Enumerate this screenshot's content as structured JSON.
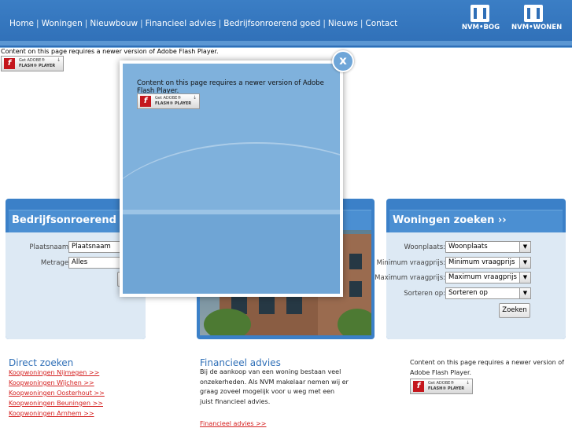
{
  "nav": {
    "items": [
      "Home",
      "Woningen",
      "Nieuwbouw",
      "Financieel advies",
      "Bedrijfsonroerend goed",
      "Nieuws",
      "Contact"
    ],
    "separator": "|"
  },
  "logos": {
    "nvm_bog": "NVM•BOG",
    "nvm_wonen": "NVM•WONEN"
  },
  "flash": {
    "message": "Content on this page requires a newer version of Adobe Flash Player.",
    "badge_line1": "Get ADOBE®",
    "badge_line2": "FLASH® PLAYER",
    "badge_icon": "f"
  },
  "modal": {
    "message": "Content on this page requires a newer version of Adobe Flash Player.",
    "close_glyph": "x"
  },
  "bog_panel": {
    "title": "Bedrijfsonroerend goed",
    "plaatsnaam_label": "Plaatsnaam:",
    "plaatsnaam_value": "Plaatsnaam",
    "metrage_label": "Metrage:",
    "metrage_value": "Alles"
  },
  "woningen_panel": {
    "title": "Woningen zoeken ››",
    "woonplaats_label": "Woonplaats:",
    "woonplaats_value": "Woonplaats",
    "min_label": "Minimum vraagprijs:",
    "min_value": "Minimum vraagprijs",
    "max_label": "Maximum vraagprijs:",
    "max_value": "Maximum vraagprijs",
    "sort_label": "Sorteren op:",
    "sort_value": "Sorteren op",
    "search_button": "Zoeken"
  },
  "direct_zoeken": {
    "title": "Direct zoeken",
    "links": [
      "Koopwoningen Nijmegen >>",
      "Koopwoningen Wijchen >>",
      "Koopwoningen Oosterhout >>",
      "Koopwoningen Beuningen >>",
      "Koopwoningen Arnhem >>"
    ]
  },
  "financieel": {
    "title": "Financieel advies",
    "lines": [
      "Bij de aankoop van een woning bestaan veel",
      "onzekerheden. Als NVM makelaar nemen wij er",
      "graag zoveel mogelijk voor u weg met een",
      "juist financieel advies."
    ],
    "link": "Financieel advies >>"
  },
  "right_flash": {
    "line1": "Content on this page requires a newer version of",
    "line2": "Adobe Flash Player."
  },
  "colors": {
    "brand_blue": "#2f6fb7",
    "link_red": "#d42020",
    "panel_bg": "#dde9f4"
  }
}
